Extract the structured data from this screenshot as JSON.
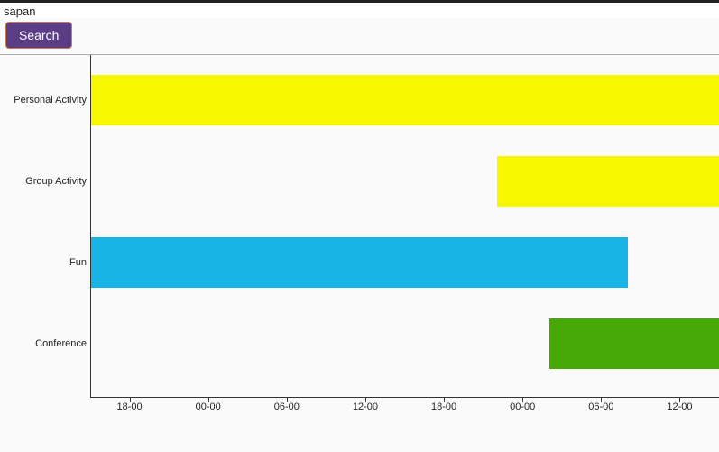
{
  "search": {
    "value": "sapan",
    "button_label": "Search"
  },
  "chart_data": {
    "type": "gantt",
    "categories": [
      "Personal Activity",
      "Group Activity",
      "Fun",
      "Conference"
    ],
    "x_ticks": [
      "18-00",
      "00-00",
      "06-00",
      "12-00",
      "18-00",
      "00-00",
      "06-00",
      "12-00"
    ],
    "x_tick_hours": [
      18,
      24,
      30,
      36,
      42,
      48,
      54,
      60
    ],
    "x_range_hours": [
      15,
      63
    ],
    "series": [
      {
        "name": "Personal Activity",
        "start_h": 15,
        "end_h": 63,
        "color": "#f7f700"
      },
      {
        "name": "Group Activity",
        "start_h": 46,
        "end_h": 63,
        "color": "#f7f700"
      },
      {
        "name": "Fun",
        "start_h": 15,
        "end_h": 56,
        "color": "#17b4e5"
      },
      {
        "name": "Conference",
        "start_h": 50,
        "end_h": 63,
        "color": "#45a805"
      }
    ],
    "xlabel": "",
    "ylabel": "",
    "title": ""
  }
}
